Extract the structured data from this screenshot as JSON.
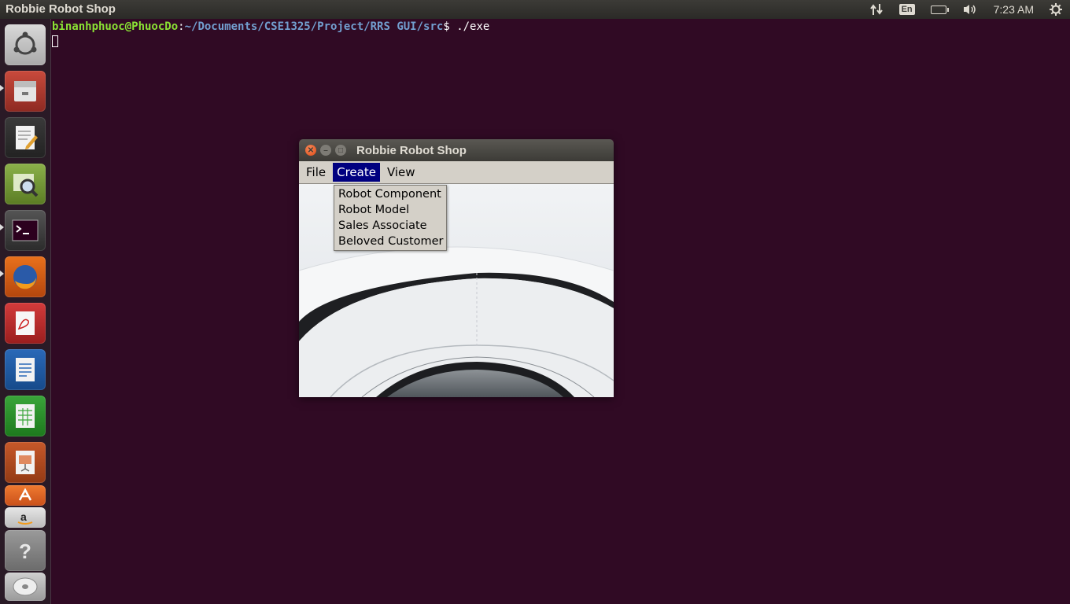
{
  "top_panel": {
    "app_title": "Robbie Robot Shop",
    "lang": "En",
    "time": "7:23 AM"
  },
  "terminal": {
    "user_host": "binanhphuoc@PhuocDo",
    "separator": ":",
    "path": "~/Documents/CSE1325/Project/RRS GUI/src",
    "prompt": "$ ",
    "command": "./exe"
  },
  "window": {
    "title": "Robbie Robot Shop",
    "menus": [
      {
        "label": "File"
      },
      {
        "label": "Create"
      },
      {
        "label": "View"
      }
    ],
    "dropdown": [
      {
        "label": "Robot Component"
      },
      {
        "label": "Robot Model"
      },
      {
        "label": "Sales Associate"
      },
      {
        "label": "Beloved Customer"
      }
    ]
  },
  "launcher": {
    "items": [
      {
        "icon": "ubuntu-dash-icon"
      },
      {
        "icon": "files-icon"
      },
      {
        "icon": "text-editor-icon"
      },
      {
        "icon": "image-viewer-icon"
      },
      {
        "icon": "terminal-icon"
      },
      {
        "icon": "firefox-icon"
      },
      {
        "icon": "document-viewer-icon"
      },
      {
        "icon": "writer-icon"
      },
      {
        "icon": "calc-icon"
      },
      {
        "icon": "impress-icon"
      },
      {
        "icon": "software-center-icon"
      },
      {
        "icon": "amazon-icon"
      },
      {
        "icon": "help-icon"
      },
      {
        "icon": "disc-icon"
      }
    ]
  },
  "colors": {
    "terminal_bg": "#300a24",
    "menu_highlight": "#000080"
  }
}
